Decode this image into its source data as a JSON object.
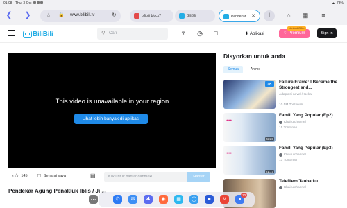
{
  "status_bar": {
    "time": "01:08",
    "date": "Thu, 3 Oct",
    "battery": "78%"
  },
  "browser": {
    "url": "www.bilibili.tv",
    "tabs": [
      {
        "label": "bilibili block?",
        "icon_color": "#e34a4a"
      },
      {
        "label": "BiliBili",
        "icon_color": "#23ade5"
      },
      {
        "label": "Pendekar ...",
        "icon_color": "#23ade5",
        "active": true
      }
    ]
  },
  "header": {
    "logo_text": "BiliBili",
    "search_placeholder": "Cari",
    "app_label": "Aplikasi",
    "premium_label": "Premium",
    "limited_offer": "Limited Offer",
    "signin_label": "Sign In"
  },
  "player": {
    "message": "This video is unavailable in your region",
    "cta_label": "Lihat lebih banyak di aplikasi"
  },
  "actions": {
    "likes": "145",
    "save_label": "Senarai saya",
    "danmaku_placeholder": "Klik untuk hantar danmaku",
    "send_label": "Hantar",
    "title_peek": "Pendekar Agung Penakluk Iblis / Ji ..."
  },
  "sidebar": {
    "heading": "Disyorkan untuk anda",
    "chips": [
      "Semua",
      "Anime"
    ],
    "items": [
      {
        "title": "Failure Frame: I Became the Strongest and...",
        "sub1": "Adaptasi novel / Isekai",
        "sub2": "10.5M Tontonan",
        "duration": "",
        "badge": "4K"
      },
      {
        "title": "Famili Yang Popular (Ep2)",
        "channel": "Khairulchannel",
        "views": "15 Tontonan",
        "duration": "22:23"
      },
      {
        "title": "Famili Yang Popular (Ep3)",
        "channel": "Khairulchannel",
        "views": "13 Tontonan",
        "duration": "21:17"
      },
      {
        "title": "Telefilem Taubatku",
        "channel": "Khairulchannel",
        "views": "",
        "duration": ""
      }
    ]
  },
  "dock": {
    "badge": "10"
  },
  "colors": {
    "accent": "#23ade5",
    "premium": "#ff6699",
    "cta": "#1f8ae8"
  }
}
